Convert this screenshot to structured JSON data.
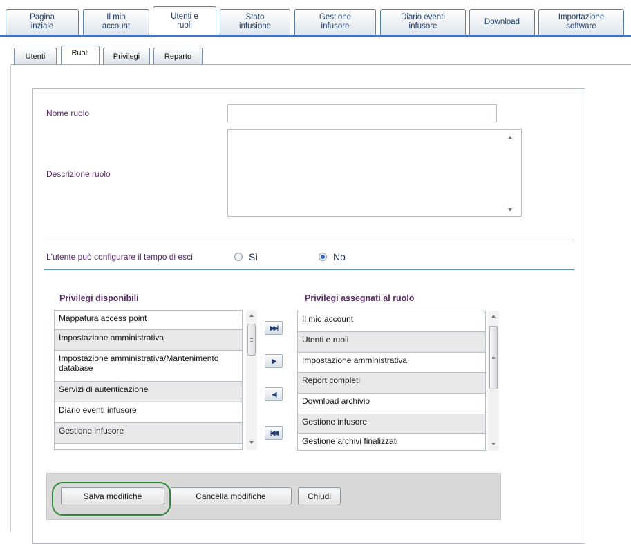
{
  "top_tabs": [
    {
      "label": "Pagina\ninziale",
      "active": false
    },
    {
      "label": "Il mio\naccount",
      "active": false
    },
    {
      "label": "Utenti e\nruoli",
      "active": true
    },
    {
      "label": "Stato\ninfusione",
      "active": false
    },
    {
      "label": "Gestione\ninfusore",
      "active": false
    },
    {
      "label": "Diario eventi\ninfusore",
      "active": false
    },
    {
      "label": "Download",
      "active": false
    },
    {
      "label": "Importazione\nsoftware",
      "active": false
    }
  ],
  "sub_tabs": [
    {
      "label": "Utenti",
      "active": false
    },
    {
      "label": "Ruoli",
      "active": true
    },
    {
      "label": "Privilegi",
      "active": false
    },
    {
      "label": "Reparto",
      "active": false
    }
  ],
  "form": {
    "role_name_label": "Nome ruolo",
    "role_name_value": "",
    "role_description_label": "Descrizione ruolo",
    "role_description_value": "",
    "exit_time_label": "L'utente può configurare il tempo di esci",
    "exit_time_options": [
      {
        "label": "Sì",
        "checked": false
      },
      {
        "label": "No",
        "checked": true
      }
    ]
  },
  "available_privileges": {
    "title": "Privilegi disponibili",
    "items": [
      "Mappatura access point",
      "Impostazione amministrativa",
      "Impostazione amministrativa/Mantenimento database",
      "Servizi di autenticazione",
      "Diario eventi infusore",
      "Gestione infusore"
    ]
  },
  "assigned_privileges": {
    "title": "Privilegi assegnati al ruolo",
    "items": [
      "Il mio account",
      "Utenti e ruoli",
      "Impostazione amministrativa",
      "Report completi",
      "Download archivio",
      "Gestione infusore",
      "Gestione archivi finalizzati"
    ]
  },
  "move_buttons": [
    {
      "name": "move-all-right-button",
      "icon": "double-arrow-right-icon",
      "glyph": "▶▶|"
    },
    {
      "name": "move-right-button",
      "icon": "arrow-right-icon",
      "glyph": "▶"
    },
    {
      "name": "move-left-button",
      "icon": "arrow-left-icon",
      "glyph": "◀"
    },
    {
      "name": "move-all-left-button",
      "icon": "double-arrow-left-icon",
      "glyph": "|◀◀"
    }
  ],
  "buttons": {
    "save": "Salva modifiche",
    "cancel": "Cancella modifiche",
    "close": "Chiudi"
  },
  "colors": {
    "tab_border": "#5b7fa6",
    "nav_bar": "#4a73b5",
    "label_purple": "#5a2a6b",
    "highlight_green": "#2e8b3a",
    "radio_selected": "#2f6ec7"
  }
}
